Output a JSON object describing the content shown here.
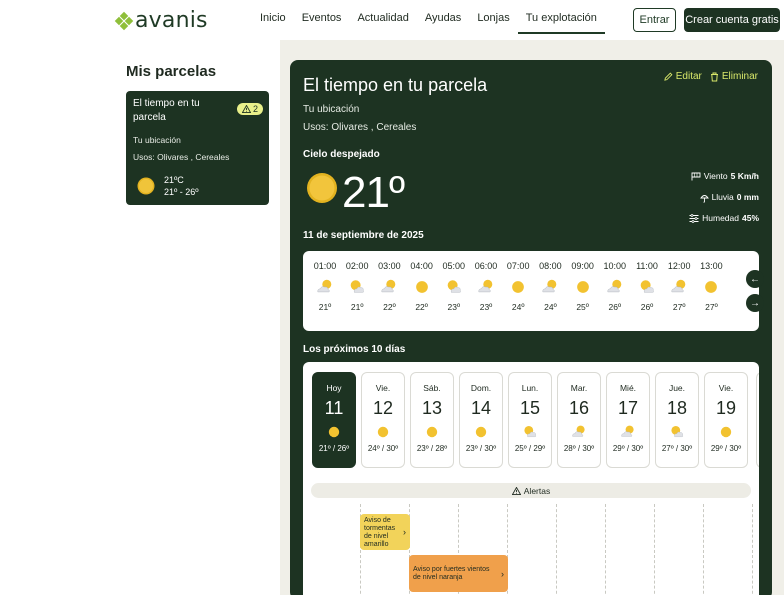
{
  "brand": {
    "name": "avanis",
    "color": "#8fbf3a"
  },
  "nav": {
    "items": [
      "Inicio",
      "Eventos",
      "Actualidad",
      "Ayudas",
      "Lonjas",
      "Tu explotación"
    ],
    "active": "Tu explotación"
  },
  "auth": {
    "login": "Entrar",
    "signup": "Crear cuenta gratis"
  },
  "sidebar": {
    "title": "Mis parcelas",
    "card": {
      "title": "El tiempo en tu parcela",
      "badge": "2",
      "location": "Tu ubicación",
      "uses": "Usos: Olivares , Cereales",
      "temp": "21ºC",
      "range": "21º - 26º"
    }
  },
  "main": {
    "title": "El tiempo en tu parcela",
    "edit": "Editar",
    "delete": "Eliminar",
    "location": "Tu ubicación",
    "uses": "Usos: Olivares , Cereales",
    "condition": "Cielo despejado",
    "temperature": "21º",
    "wind_label": "Viento",
    "wind_value": "5 Km/h",
    "rain_label": "Lluvia",
    "rain_value": "0 mm",
    "humidity_label": "Humedad",
    "humidity_value": "45%",
    "date": "11 de septiembre de 2025",
    "hourly": [
      {
        "time": "01:00",
        "icon": "moon-cloud-icon",
        "temp": "21º"
      },
      {
        "time": "02:00",
        "icon": "sun-cloud-icon",
        "temp": "21º"
      },
      {
        "time": "03:00",
        "icon": "moon-cloud-icon",
        "temp": "22º"
      },
      {
        "time": "04:00",
        "icon": "sun-icon",
        "temp": "22º"
      },
      {
        "time": "05:00",
        "icon": "sun-cloud-icon",
        "temp": "23º"
      },
      {
        "time": "06:00",
        "icon": "moon-cloud-icon",
        "temp": "23º"
      },
      {
        "time": "07:00",
        "icon": "sun-icon",
        "temp": "24º"
      },
      {
        "time": "08:00",
        "icon": "moon-cloud-icon",
        "temp": "24º"
      },
      {
        "time": "09:00",
        "icon": "sun-icon",
        "temp": "25º"
      },
      {
        "time": "10:00",
        "icon": "moon-cloud-icon",
        "temp": "26º"
      },
      {
        "time": "11:00",
        "icon": "sun-cloud-icon",
        "temp": "26º"
      },
      {
        "time": "12:00",
        "icon": "moon-cloud-icon",
        "temp": "27º"
      },
      {
        "time": "13:00",
        "icon": "sun-icon",
        "temp": "27º"
      }
    ],
    "next_days_title": "Los próximos 10 días",
    "days": [
      {
        "name": "Hoy",
        "num": "11",
        "icon": "sun-icon",
        "range": "21º / 26º"
      },
      {
        "name": "Vie.",
        "num": "12",
        "icon": "sun-icon",
        "range": "24º / 30º"
      },
      {
        "name": "Sáb.",
        "num": "13",
        "icon": "sun-icon",
        "range": "23º / 28º"
      },
      {
        "name": "Dom.",
        "num": "14",
        "icon": "sun-icon",
        "range": "23º / 30º"
      },
      {
        "name": "Lun.",
        "num": "15",
        "icon": "sun-cloud-icon",
        "range": "25º / 29º"
      },
      {
        "name": "Mar.",
        "num": "16",
        "icon": "moon-cloud-icon",
        "range": "28º / 30º"
      },
      {
        "name": "Mié.",
        "num": "17",
        "icon": "moon-cloud-icon",
        "range": "29º / 30º"
      },
      {
        "name": "Jue.",
        "num": "18",
        "icon": "sun-cloud-icon",
        "range": "27º / 30º"
      },
      {
        "name": "Vie.",
        "num": "19",
        "icon": "sun-icon",
        "range": "29º / 30º"
      }
    ],
    "alerts_label": "Alertas",
    "alert_yellow": "Aviso de tormentas de nivel amarillo",
    "alert_orange": "Aviso por fuertes vientos de nivel naranja"
  },
  "colors": {
    "panel": "#1d3322",
    "accent": "#d9e86a",
    "alert_yellow": "#f2d35a",
    "alert_orange": "#f0a04b"
  }
}
